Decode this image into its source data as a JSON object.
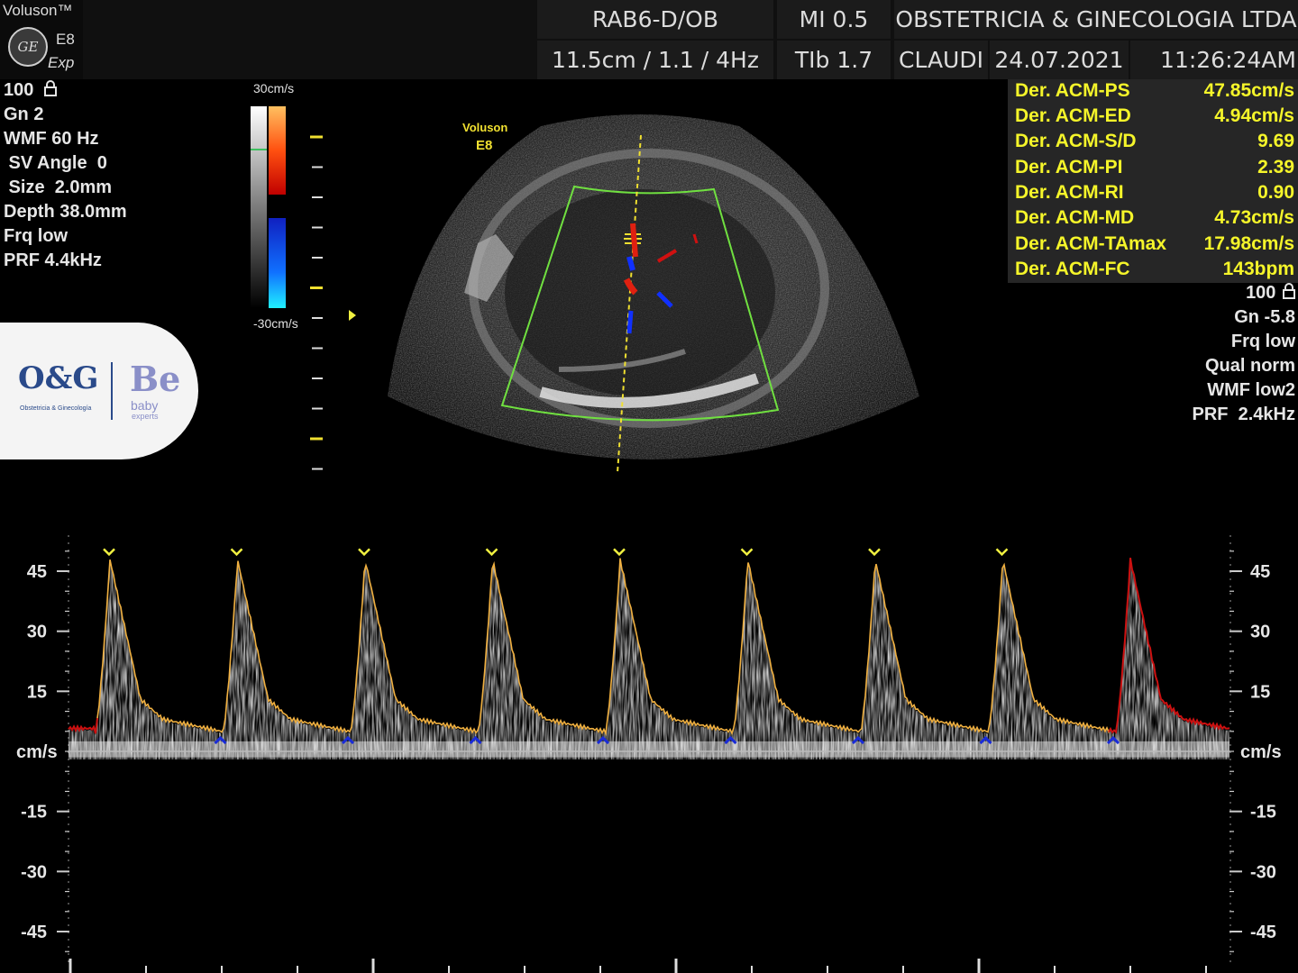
{
  "brand": {
    "name": "Voluson™",
    "logo_text": "GE",
    "model": "E8",
    "suffix": "Exp"
  },
  "header": {
    "probe": "RAB6-D/OB",
    "mi": "MI  0.5",
    "institution": "OBSTETRICIA & GINECOLOGIA LTDA",
    "depth_settings": "11.5cm / 1.1 /  4Hz",
    "tib": "TIb  1.7",
    "operator": "CLAUDI",
    "date": "24.07.2021",
    "time": "11:26:24AM"
  },
  "left_params": [
    "100",
    "Gn  2",
    "WMF 60 Hz",
    " SV Angle  0",
    " Size  2.0mm",
    "Depth 38.0mm",
    "Frq low",
    "PRF  4.4kHz"
  ],
  "colorbar": {
    "top_label": "30cm/s",
    "bottom_label": "-30cm/s"
  },
  "image_label": {
    "line1": "Voluson",
    "line2": "E8"
  },
  "measurements": [
    {
      "label": "Der. ACM-PS",
      "value": "47.85cm/s"
    },
    {
      "label": "Der. ACM-ED",
      "value": "4.94cm/s"
    },
    {
      "label": "Der. ACM-S/D",
      "value": "9.69"
    },
    {
      "label": "Der. ACM-PI",
      "value": "2.39"
    },
    {
      "label": "Der. ACM-RI",
      "value": "0.90"
    },
    {
      "label": "Der. ACM-MD",
      "value": "4.73cm/s"
    },
    {
      "label": "Der. ACM-TAmax",
      "value": "17.98cm/s"
    },
    {
      "label": "Der. ACM-FC",
      "value": "143bpm"
    }
  ],
  "right_params": [
    "100",
    "Gn -5.8",
    "Frq low",
    "Qual norm",
    "WMF low2",
    "PRF  2.4kHz"
  ],
  "logo": {
    "og_text": "O&G",
    "og_subtitle": "Obstetricia & Ginecología",
    "be_text": "Be",
    "be_sub1": "baby",
    "be_sub2": "experts"
  },
  "spectral": {
    "unit_label": "cm/s",
    "ticks": [
      45,
      30,
      15,
      -15,
      -30,
      -45
    ],
    "range": [
      -50,
      55
    ],
    "peak_velocity": 47.85,
    "end_diastolic_velocity": 4.94,
    "cycles": 9,
    "colors": {
      "envelope": "#f0b040",
      "last_envelope": "#cc1010",
      "peak_marker": "#f0f040",
      "min_marker": "#1a2cd8",
      "baseline": "#bbbbbb"
    }
  }
}
